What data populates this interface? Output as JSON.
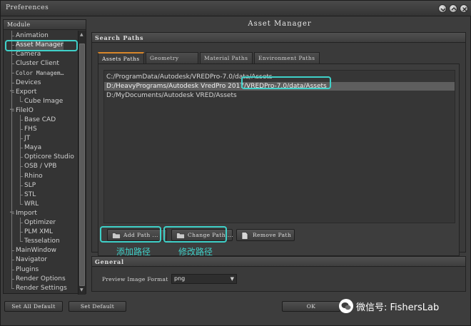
{
  "window": {
    "title": "Preferences"
  },
  "sidebar": {
    "header": "Module",
    "items": [
      {
        "label": "Animation",
        "level": 0
      },
      {
        "label": "Asset Manager",
        "level": 0
      },
      {
        "label": "Camera",
        "level": 0
      },
      {
        "label": "Cluster Client",
        "level": 0
      },
      {
        "label": "Color Managem…",
        "level": 0
      },
      {
        "label": "Devices",
        "level": 0
      },
      {
        "label": "Export",
        "level": 0
      },
      {
        "label": "Cube Image",
        "level": 1
      },
      {
        "label": "FileIO",
        "level": 0
      },
      {
        "label": "Base CAD",
        "level": 1
      },
      {
        "label": "FHS",
        "level": 1
      },
      {
        "label": "JT",
        "level": 1
      },
      {
        "label": "Maya",
        "level": 1
      },
      {
        "label": "Opticore Studio",
        "level": 1
      },
      {
        "label": "OSB / VPB",
        "level": 1
      },
      {
        "label": "Rhino",
        "level": 1
      },
      {
        "label": "SLP",
        "level": 1
      },
      {
        "label": "STL",
        "level": 1
      },
      {
        "label": "WRL",
        "level": 1
      },
      {
        "label": "Import",
        "level": 0
      },
      {
        "label": "Optimizer",
        "level": 1
      },
      {
        "label": "PLM XML",
        "level": 1
      },
      {
        "label": "Tesselation",
        "level": 1
      },
      {
        "label": "MainWindow",
        "level": 0
      },
      {
        "label": "Navigator",
        "level": 0
      },
      {
        "label": "Plugins",
        "level": 0
      },
      {
        "label": "Render Options",
        "level": 0
      },
      {
        "label": "Render Settings",
        "level": 0
      }
    ]
  },
  "main": {
    "title": "Asset Manager",
    "search_paths": {
      "header": "Search Paths",
      "tabs": [
        "Assets Paths",
        "Geometry Paths",
        "Material Paths",
        "Environment Paths"
      ],
      "paths": [
        "C:/ProgramData/Autodesk/VREDPro-7.0/data/Assets",
        "D:/HeavyPrograms/Autodesk VredPro 2017/VREDPro-7.0/data/Assets",
        "D:/MyDocuments/Autodesk VRED/Assets"
      ],
      "buttons": {
        "add": "Add Path ...",
        "change": "Change Path ...",
        "remove": "Remove Path"
      },
      "annotations": {
        "add": "添加路径",
        "change": "修改路径"
      }
    },
    "general": {
      "header": "General",
      "preview_label": "Preview Image Format",
      "preview_value": "png"
    }
  },
  "footer": {
    "set_all_default": "Set All Default",
    "set_default": "Set Default",
    "ok": "OK"
  },
  "watermark": {
    "text": "微信号: FishersLab"
  },
  "colors": {
    "highlight": "#3fd1c9",
    "active_tab": "#d8862a"
  }
}
